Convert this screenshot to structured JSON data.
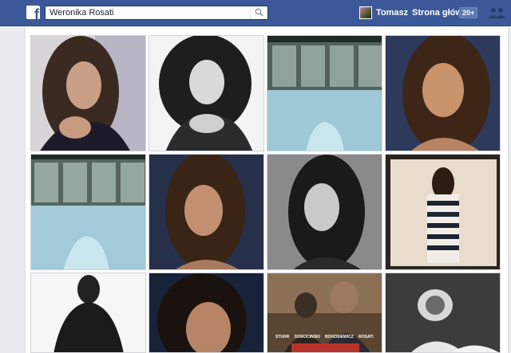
{
  "header": {
    "search_value": "Weronika Rosati",
    "profile_name": "Tomasz",
    "home_label": "Strona główna",
    "home_badge": "20+"
  },
  "colors": {
    "brand": "#3b5998",
    "page_bg": "#e9ebee"
  },
  "grid": {
    "photos": [
      "photo-1",
      "photo-2",
      "photo-3",
      "photo-4",
      "photo-5",
      "photo-6",
      "photo-7",
      "photo-8",
      "photo-9",
      "photo-10",
      "photo-11",
      "photo-12"
    ],
    "poster": {
      "names": [
        "STUHR",
        "DOROCINSKI",
        "BOHOSIEWICZ",
        "ROSATI"
      ]
    }
  }
}
